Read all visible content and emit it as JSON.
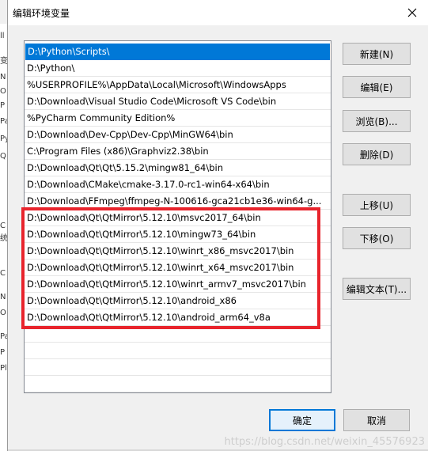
{
  "window": {
    "title": "编辑环境变量"
  },
  "background_fragments": [
    "ll",
    "变",
    "N",
    "O",
    "P",
    "Pa",
    "Py",
    "Q",
    "C",
    "统",
    "C",
    "N",
    "O",
    "Pa",
    "P",
    "Pl"
  ],
  "paths": [
    "D:\\Python\\Scripts\\",
    "D:\\Python\\",
    "%USERPROFILE%\\AppData\\Local\\Microsoft\\WindowsApps",
    "D:\\Download\\Visual Studio Code\\Microsoft VS Code\\bin",
    "%PyCharm Community Edition%",
    "D:\\Download\\Dev-Cpp\\Dev-Cpp\\MinGW64\\bin",
    "C:\\Program Files (x86)\\Graphviz2.38\\bin",
    "D:\\Download\\Qt\\Qt\\5.15.2\\mingw81_64\\bin",
    "D:\\Download\\CMake\\cmake-3.17.0-rc1-win64-x64\\bin",
    "D:\\Download\\FFmpeg\\ffmpeg-N-100616-gca21cb1e36-win64-g...",
    "D:\\Download\\Qt\\QtMirror\\5.12.10\\msvc2017_64\\bin",
    "D:\\Download\\Qt\\QtMirror\\5.12.10\\mingw73_64\\bin",
    "D:\\Download\\Qt\\QtMirror\\5.12.10\\winrt_x86_msvc2017\\bin",
    "D:\\Download\\Qt\\QtMirror\\5.12.10\\winrt_x64_msvc2017\\bin",
    "D:\\Download\\Qt\\QtMirror\\5.12.10\\winrt_armv7_msvc2017\\bin",
    "D:\\Download\\Qt\\QtMirror\\5.12.10\\android_x86",
    "D:\\Download\\Qt\\QtMirror\\5.12.10\\android_arm64_v8a",
    "",
    "",
    "",
    ""
  ],
  "selected_index": 0,
  "buttons": {
    "new": "新建(N)",
    "edit": "编辑(E)",
    "browse": "浏览(B)...",
    "delete": "删除(D)",
    "move_up": "上移(U)",
    "move_down": "下移(O)",
    "edit_text": "编辑文本(T)...",
    "ok": "确定",
    "cancel": "取消"
  },
  "watermark": "https://blog.csdn.net/weixin_45576923",
  "colors": {
    "selection": "#0078d7",
    "highlight_box": "#e8242c"
  }
}
